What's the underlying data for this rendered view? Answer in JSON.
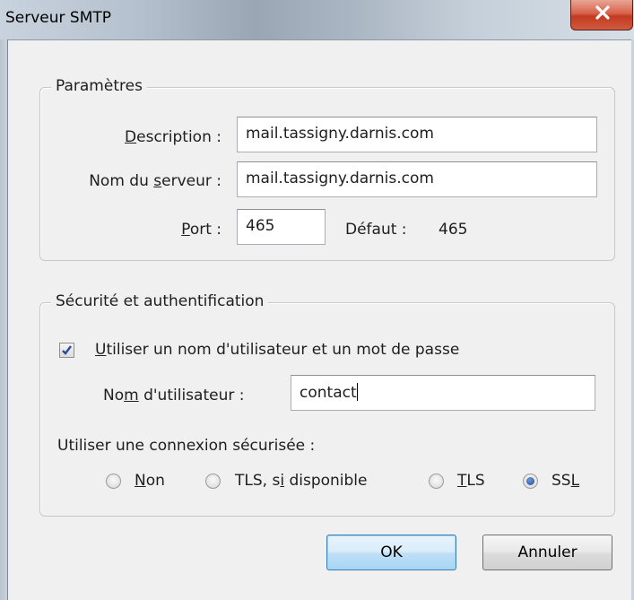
{
  "window": {
    "title": "Serveur SMTP"
  },
  "parametres": {
    "group_title": "Paramètres",
    "description": {
      "label_key": "D",
      "label_rest": "escription :",
      "value": "mail.tassigny.darnis.com"
    },
    "server_name": {
      "label_pre": "Nom du ",
      "label_key": "s",
      "label_rest": "erveur :",
      "value": "mail.tassigny.darnis.com"
    },
    "port": {
      "label_key": "P",
      "label_rest": "ort :",
      "value": "465",
      "default_label": "Défaut :",
      "default_value": "465"
    }
  },
  "security": {
    "group_title": "Sécurité et authentification",
    "use_credentials": {
      "checked": true,
      "label_key": "U",
      "label_rest": "tiliser un nom d'utilisateur et un mot de passe"
    },
    "username": {
      "label_pre": "No",
      "label_key": "m",
      "label_rest": " d'utilisateur :",
      "value": "contact"
    },
    "connection_label": "Utiliser une connexion sécurisée :",
    "options": [
      {
        "label_pre": "",
        "label_key": "N",
        "label_rest": "on",
        "selected": false
      },
      {
        "label_pre": "TLS, s",
        "label_key": "i",
        "label_rest": " disponible",
        "selected": false
      },
      {
        "label_pre": "",
        "label_key": "T",
        "label_rest": "LS",
        "selected": false
      },
      {
        "label_pre": "SS",
        "label_key": "L",
        "label_rest": "",
        "selected": true
      }
    ]
  },
  "buttons": {
    "ok": "OK",
    "cancel": "Annuler"
  }
}
